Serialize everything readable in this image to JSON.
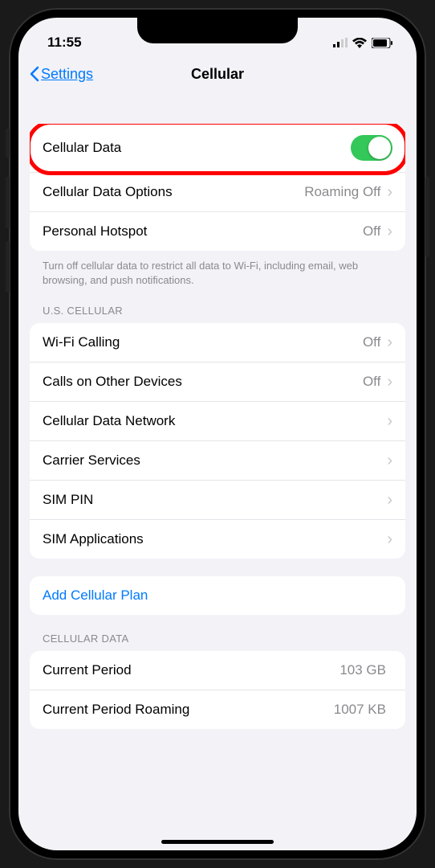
{
  "status": {
    "time": "11:55"
  },
  "nav": {
    "back": "Settings",
    "title": "Cellular"
  },
  "section1": {
    "cellular_data": "Cellular Data",
    "cellular_data_options": "Cellular Data Options",
    "cellular_data_options_value": "Roaming Off",
    "personal_hotspot": "Personal Hotspot",
    "personal_hotspot_value": "Off",
    "footer": "Turn off cellular data to restrict all data to Wi-Fi, including email, web browsing, and push notifications."
  },
  "section2": {
    "header": "U.S. CELLULAR",
    "wifi_calling": "Wi-Fi Calling",
    "wifi_calling_value": "Off",
    "calls_other": "Calls on Other Devices",
    "calls_other_value": "Off",
    "data_network": "Cellular Data Network",
    "carrier_services": "Carrier Services",
    "sim_pin": "SIM PIN",
    "sim_apps": "SIM Applications"
  },
  "section3": {
    "add_plan": "Add Cellular Plan"
  },
  "section4": {
    "header": "CELLULAR DATA",
    "current_period": "Current Period",
    "current_period_value": "103 GB",
    "current_period_roaming": "Current Period Roaming",
    "current_period_roaming_value": "1007 KB"
  }
}
